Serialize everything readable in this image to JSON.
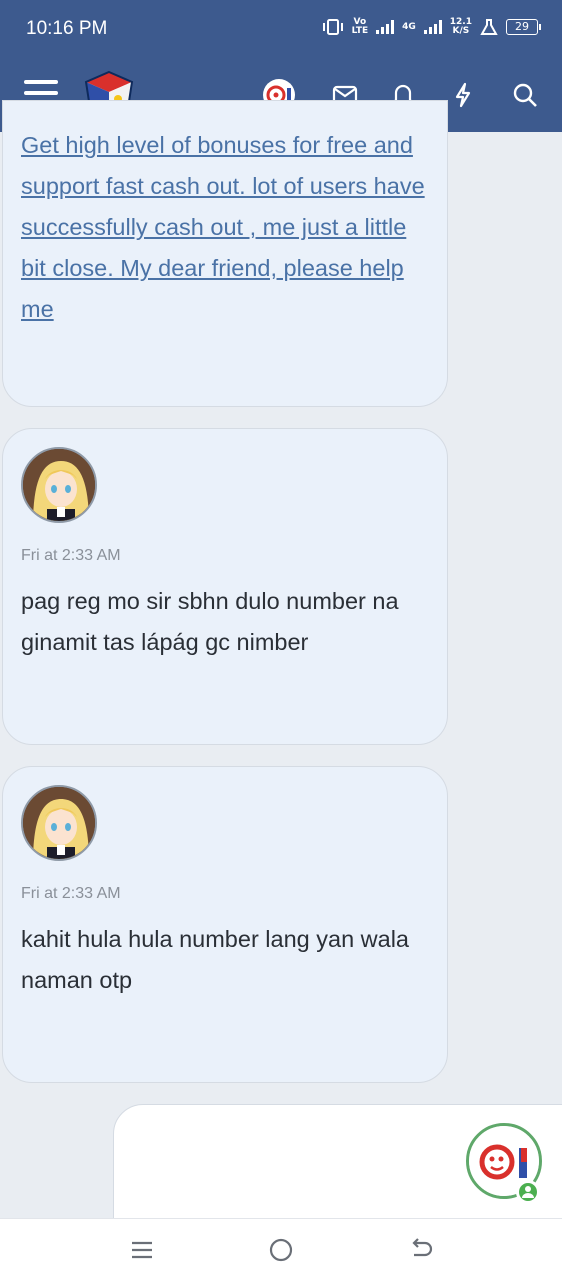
{
  "status_bar": {
    "time": "10:16 PM",
    "volte_label_top": "Vo",
    "volte_label_bottom": "LTE",
    "network_4g": "4G",
    "speed_value": "12.1",
    "speed_unit": "K/S",
    "battery_level": "29"
  },
  "app_bar": {
    "icons": [
      "menu-icon",
      "site-logo",
      "user-avatar",
      "mail-icon",
      "bell-icon",
      "lightning-icon",
      "search-icon"
    ]
  },
  "messages": [
    {
      "text": "Get high level of bonuses for free and support fast cash out. lot of users have successfully cash out , me just a little bit close. My dear friend, please help me",
      "is_link": true
    },
    {
      "time": "Fri at 2:33 AM",
      "text": "pag reg mo sir sbhn dulo number na ginamit tas lápág gc nimber"
    },
    {
      "time": "Fri at 2:33 AM",
      "text": "kahit hula hula number lang yan wala naman otp"
    }
  ],
  "colors": {
    "header_bg": "#3d5a8e",
    "page_bg": "#e9edf2",
    "bubble_bg": "#eaf1fa",
    "link": "#4a72a6",
    "online": "#4caf50"
  },
  "nav_bar": {
    "buttons": [
      "recents-icon",
      "home-icon",
      "back-icon"
    ]
  }
}
